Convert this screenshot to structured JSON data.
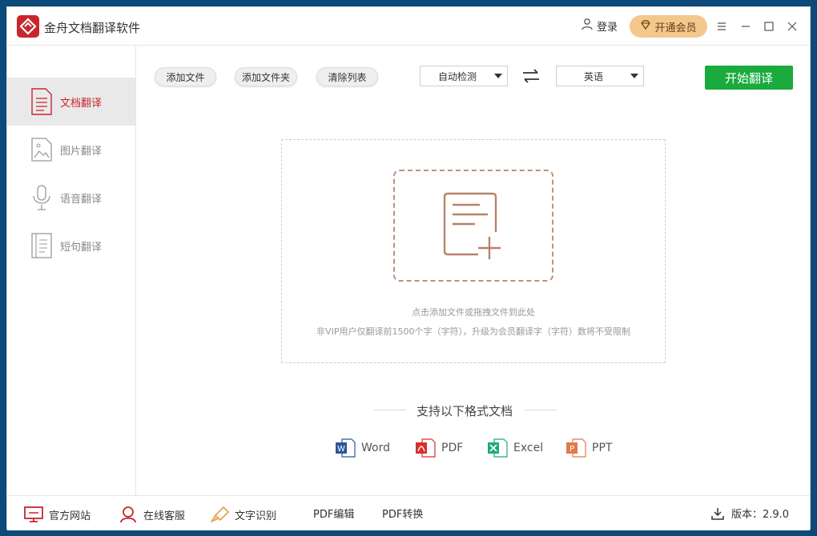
{
  "app": {
    "title": "金舟文档翻译软件"
  },
  "header": {
    "login": "登录",
    "vip": "开通会员"
  },
  "sidebar": {
    "items": [
      {
        "label": "文档翻译",
        "icon": "document-icon",
        "active": true
      },
      {
        "label": "图片翻译",
        "icon": "image-icon",
        "active": false
      },
      {
        "label": "语音翻译",
        "icon": "microphone-icon",
        "active": false
      },
      {
        "label": "短句翻译",
        "icon": "sentence-icon",
        "active": false
      }
    ]
  },
  "toolbar": {
    "add_file": "添加文件",
    "add_folder": "添加文件夹",
    "clear_list": "清除列表",
    "source_lang": "自动检测",
    "target_lang": "英语",
    "start": "开始翻译"
  },
  "dropzone": {
    "hint": "点击添加文件或拖拽文件到此处",
    "limit_note": "非VIP用户仅翻译前1500个字（字符），升级为会员翻译字（字符）数将不受限制"
  },
  "formats": {
    "title": "支持以下格式文档",
    "items": [
      {
        "label": "Word",
        "color": "#2b579a"
      },
      {
        "label": "PDF",
        "color": "#d92d2d"
      },
      {
        "label": "Excel",
        "color": "#1fa97e"
      },
      {
        "label": "PPT",
        "color": "#e07a4a"
      }
    ]
  },
  "footer": {
    "website": "官方网站",
    "service": "在线客服",
    "ocr": "文字识别",
    "pdf_edit": "PDF编辑",
    "pdf_convert": "PDF转换",
    "version": "版本：2.9.0"
  },
  "colors": {
    "accent": "#c8262c",
    "start_button": "#1aaa3d",
    "vip": "#f4c78d"
  }
}
